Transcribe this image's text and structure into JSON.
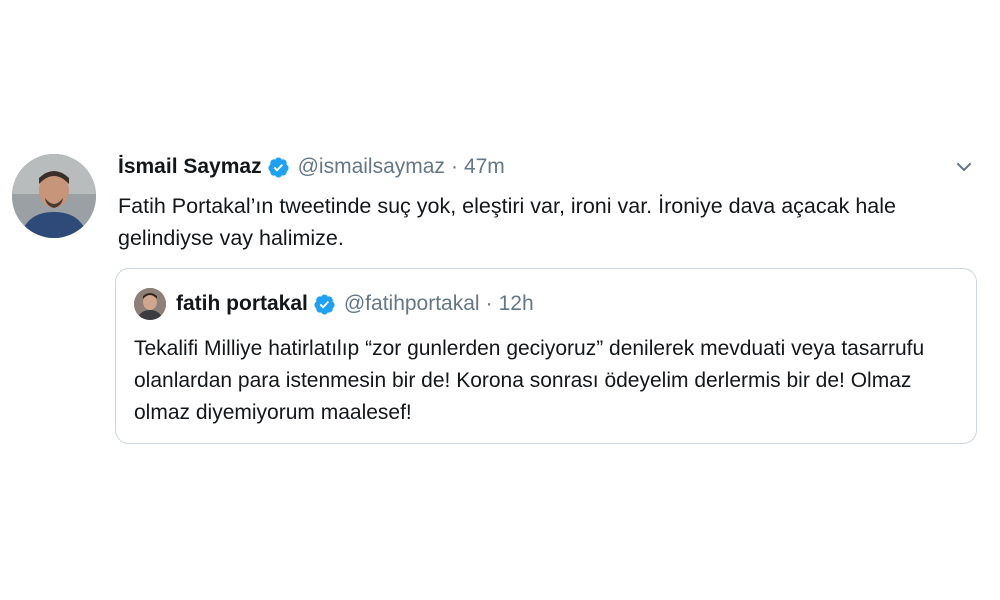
{
  "tweet": {
    "author_name": "İsmail Saymaz",
    "handle": "@ismailsaymaz",
    "separator": "·",
    "time": "47m",
    "verified_icon": "verified-badge-icon",
    "menu_icon": "chevron-down-icon",
    "text": "Fatih Portakal’ın tweetinde suç yok, eleştiri var, ironi var. İroniye dava açacak hale gelindiyse vay halimize."
  },
  "quoted_tweet": {
    "author_name": "fatih portakal",
    "handle": "@fatihportakal",
    "separator": "·",
    "time": "12h",
    "verified_icon": "verified-badge-icon",
    "text": "Tekalifi Milliye hatirlatılıp “zor gunlerden geciyoruz” denilerek mevduati veya tasarrufu olanlardan para istenmesin bir de! Korona sonrası ödeyelim derlermis bir de! Olmaz olmaz diyemiyorum maalesef!"
  },
  "colors": {
    "verified": "#1da1f2",
    "secondary_text": "#657786",
    "border": "#ccd6dd"
  }
}
